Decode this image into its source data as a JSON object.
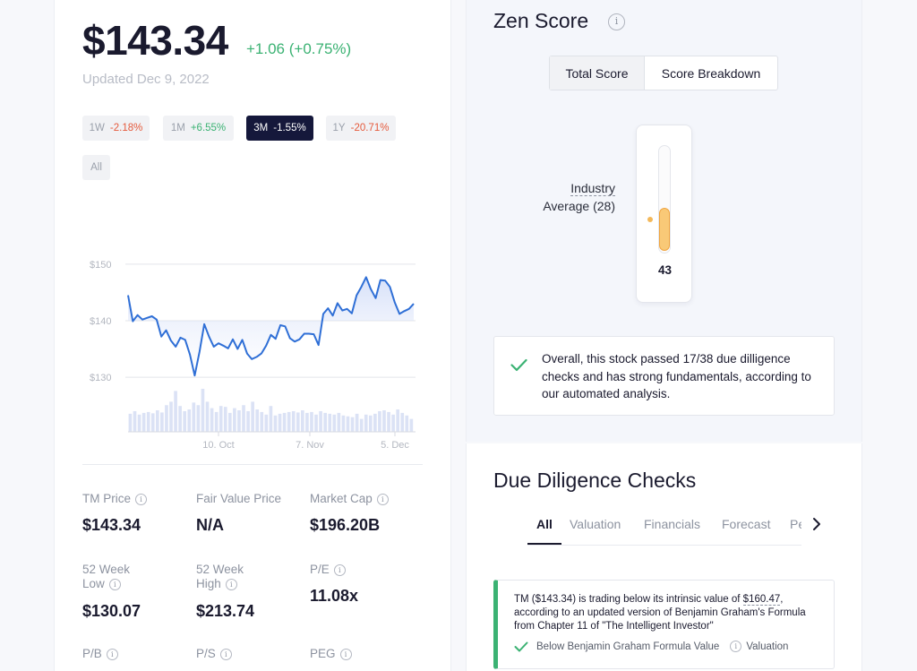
{
  "quote": {
    "price": "$143.34",
    "change": "+1.06 (+0.75%)",
    "updated": "Updated Dec 9, 2022"
  },
  "periods": [
    {
      "label": "1W",
      "change": "-2.18%",
      "dir": "neg",
      "active": false
    },
    {
      "label": "1M",
      "change": "+6.55%",
      "dir": "pos",
      "active": false
    },
    {
      "label": "3M",
      "change": "-1.55%",
      "dir": "neg",
      "active": true
    },
    {
      "label": "1Y",
      "change": "-20.71%",
      "dir": "neg",
      "active": false
    },
    {
      "label": "All",
      "change": "",
      "dir": "",
      "active": false
    }
  ],
  "chart_data": {
    "type": "line",
    "y_ticks": [
      "$150",
      "$140",
      "$130"
    ],
    "y_tick_values": [
      150,
      140,
      130
    ],
    "ylim": [
      127,
      153
    ],
    "x_labels": [
      "10. Oct",
      "7. Nov",
      "5. Dec"
    ],
    "line_color": "#2f6fd6",
    "series": [
      {
        "values": [
          144.5,
          139.9,
          141.0,
          140.2,
          140.5,
          140.8,
          140.2,
          137.2,
          138.3,
          136.5,
          135.4,
          137.0,
          136.6,
          134.0,
          130.3,
          134.5,
          139.4,
          137.2,
          135.4,
          136.0,
          135.6,
          135.1,
          136.7,
          135.0,
          136.6,
          134.2,
          133.2,
          133.6,
          134.2,
          135.6,
          137.5,
          136.8,
          139.2,
          139.0,
          136.9,
          136.3,
          136.7,
          137.7,
          137.7,
          137.6,
          135.7,
          141.2,
          142.2,
          140.9,
          143.1,
          141.8,
          142.1,
          141.3,
          144.5,
          146.0,
          147.7,
          145.6,
          144.0,
          147.2,
          147.1,
          146.0,
          143.3,
          141.2,
          141.7,
          142.1,
          143.0
        ]
      }
    ],
    "volume": [
      0.42,
      0.48,
      0.4,
      0.44,
      0.46,
      0.43,
      0.5,
      0.45,
      0.62,
      0.7,
      0.95,
      0.6,
      0.48,
      0.52,
      0.68,
      0.62,
      1.0,
      0.7,
      0.55,
      0.46,
      0.6,
      0.58,
      0.44,
      0.55,
      0.5,
      0.62,
      0.48,
      0.7,
      0.52,
      0.46,
      0.4,
      0.6,
      0.38,
      0.42,
      0.44,
      0.46,
      0.48,
      0.45,
      0.5,
      0.44,
      0.46,
      0.4,
      0.48,
      0.44,
      0.42,
      0.4,
      0.44,
      0.38,
      0.36,
      0.34,
      0.42,
      0.3,
      0.4,
      0.38,
      0.42,
      0.48,
      0.5,
      0.46,
      0.4,
      0.52,
      0.44,
      0.38,
      0.3
    ]
  },
  "stats": [
    {
      "label": "TM Price",
      "value": "$143.34",
      "info": true
    },
    {
      "label": "Fair Value Price",
      "value": "N/A",
      "info": false
    },
    {
      "label": "Market Cap",
      "value": "$196.20B",
      "info": true
    },
    {
      "label": "52 Week Low",
      "value": "$130.07",
      "info": true
    },
    {
      "label": "52 Week High",
      "value": "$213.74",
      "info": true
    },
    {
      "label": "P/E",
      "value": "11.08x",
      "info": true
    },
    {
      "label": "P/B",
      "value": "",
      "info": true
    },
    {
      "label": "P/S",
      "value": "",
      "info": true
    },
    {
      "label": "PEG",
      "value": "",
      "info": true
    }
  ],
  "zen": {
    "title": "Zen Score",
    "info_icon": "i",
    "seg_total": "Total Score",
    "seg_breakdown": "Score Breakdown",
    "industry_line1": "Industry",
    "industry_line2": "Average (28)",
    "industry_average": 28,
    "score": "43",
    "score_value": 43,
    "summary": "Overall, this stock passed 17/38 due dilligence checks and has strong fundamentals, according to our automated analysis."
  },
  "due_diligence": {
    "title": "Due Diligence Checks",
    "tabs": [
      "All",
      "Valuation",
      "Financials",
      "Forecast",
      "Pe"
    ],
    "check": {
      "desc_prefix": "TM ($143.34) is trading below its intrinsic value of ",
      "desc_value": "$160.47",
      "desc_suffix": ", according to an updated version of Benjamin Graham's Formula from Chapter 11 of \"The Intelligent Investor\"",
      "result": "Below Benjamin Graham Formula Value",
      "category": "Valuation"
    }
  },
  "colors": {
    "positive": "#3bb273",
    "negative": "#e55a3c",
    "active_pill": "#15183b",
    "gauge_fill": "#f9c977"
  }
}
